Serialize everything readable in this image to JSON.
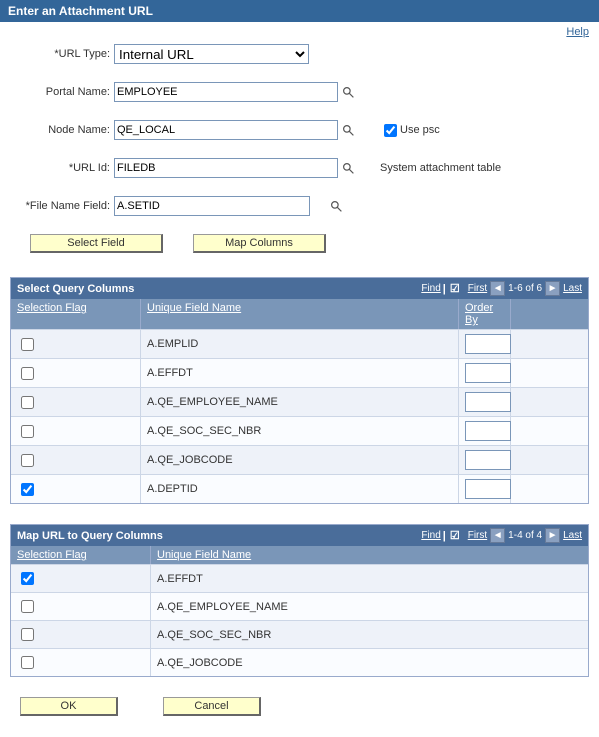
{
  "header": {
    "title": "Enter an Attachment URL"
  },
  "help": {
    "label": "Help"
  },
  "form": {
    "url_type": {
      "label": "*URL Type:",
      "value": "Internal URL"
    },
    "portal_name": {
      "label": "Portal Name:",
      "value": "EMPLOYEE"
    },
    "node_name": {
      "label": "Node Name:",
      "value": "QE_LOCAL"
    },
    "use_psc": {
      "label": "Use psc",
      "checked": true
    },
    "url_id": {
      "label": "*URL Id:",
      "value": "FILEDB"
    },
    "sys_note": "System attachment table",
    "file_name_field": {
      "label": "*File Name Field:",
      "value": "A.SETID"
    }
  },
  "buttons": {
    "select_field": "Select Field",
    "map_columns": "Map Columns",
    "ok": "OK",
    "cancel": "Cancel"
  },
  "grid1": {
    "title": "Select Query Columns",
    "find": "Find",
    "nav_first": "First",
    "nav_last": "Last",
    "nav_range": "1-6 of 6",
    "headers": {
      "selection": "Selection Flag",
      "field": "Unique Field Name",
      "order": "Order By"
    },
    "rows": [
      {
        "checked": false,
        "field": "A.EMPLID",
        "order": ""
      },
      {
        "checked": false,
        "field": "A.EFFDT",
        "order": ""
      },
      {
        "checked": false,
        "field": "A.QE_EMPLOYEE_NAME",
        "order": ""
      },
      {
        "checked": false,
        "field": "A.QE_SOC_SEC_NBR",
        "order": ""
      },
      {
        "checked": false,
        "field": "A.QE_JOBCODE",
        "order": ""
      },
      {
        "checked": true,
        "field": "A.DEPTID",
        "order": ""
      }
    ]
  },
  "grid2": {
    "title": "Map URL to Query Columns",
    "find": "Find",
    "nav_first": "First",
    "nav_last": "Last",
    "nav_range": "1-4 of 4",
    "headers": {
      "selection": "Selection Flag",
      "field": "Unique Field Name"
    },
    "rows": [
      {
        "checked": true,
        "field": "A.EFFDT"
      },
      {
        "checked": false,
        "field": "A.QE_EMPLOYEE_NAME"
      },
      {
        "checked": false,
        "field": "A.QE_SOC_SEC_NBR"
      },
      {
        "checked": false,
        "field": "A.QE_JOBCODE"
      }
    ]
  }
}
